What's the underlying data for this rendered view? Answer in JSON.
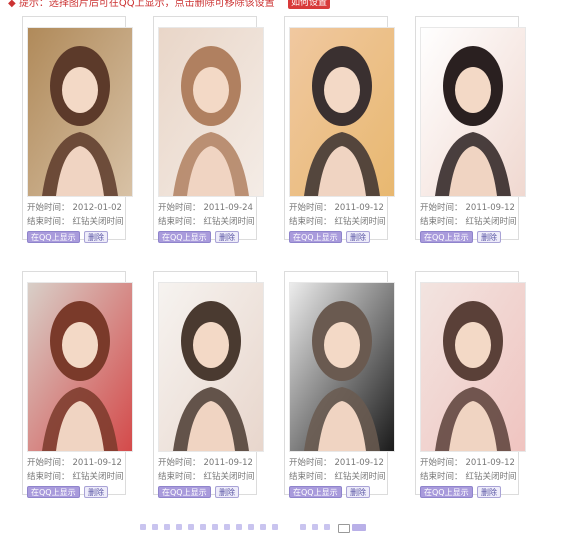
{
  "topbar": {
    "notice": "◆ 提示：选择图片后可在QQ上显示，点击删除可移除该设置",
    "flag_label": "如何设置"
  },
  "labels": {
    "start": "开始时间：",
    "end": "结束时间：",
    "end_value": "红钻关闭时间",
    "qq_button": "在QQ上显示",
    "delete_button": "删除"
  },
  "cards": [
    {
      "start_date": "2012-01-02",
      "photo_icon": "photo-girl-quilted-wall",
      "colors": [
        "#b08a5a",
        "#5c3a2a",
        "#d8c2a6"
      ]
    },
    {
      "start_date": "2011-09-24",
      "photo_icon": "photo-girl-lying",
      "colors": [
        "#e9d6c8",
        "#b08060",
        "#f4ece6"
      ]
    },
    {
      "start_date": "2011-09-12",
      "photo_icon": "photo-couple",
      "colors": [
        "#f0c8a0",
        "#3a3030",
        "#e8b870"
      ]
    },
    {
      "start_date": "2011-09-12",
      "photo_icon": "photo-girl-dark-hair",
      "colors": [
        "#ffffff",
        "#2a2020",
        "#f0d8d0"
      ]
    },
    {
      "start_date": "2011-09-12",
      "photo_icon": "photo-girl-striped-top",
      "colors": [
        "#d8cfc8",
        "#7a3a2a",
        "#d44a4a"
      ]
    },
    {
      "start_date": "2011-09-12",
      "photo_icon": "photo-girl-sitting",
      "colors": [
        "#f6f3f0",
        "#4a3a30",
        "#e8d6cc"
      ]
    },
    {
      "start_date": "2011-09-12",
      "photo_icon": "photo-girl-sunglasses",
      "colors": [
        "#ececec",
        "#6a5a50",
        "#1a1a1a"
      ]
    },
    {
      "start_date": "2011-09-12",
      "photo_icon": "photo-girl-pink-dress",
      "colors": [
        "#f2e4e0",
        "#5a4038",
        "#f0c4c0"
      ]
    }
  ]
}
